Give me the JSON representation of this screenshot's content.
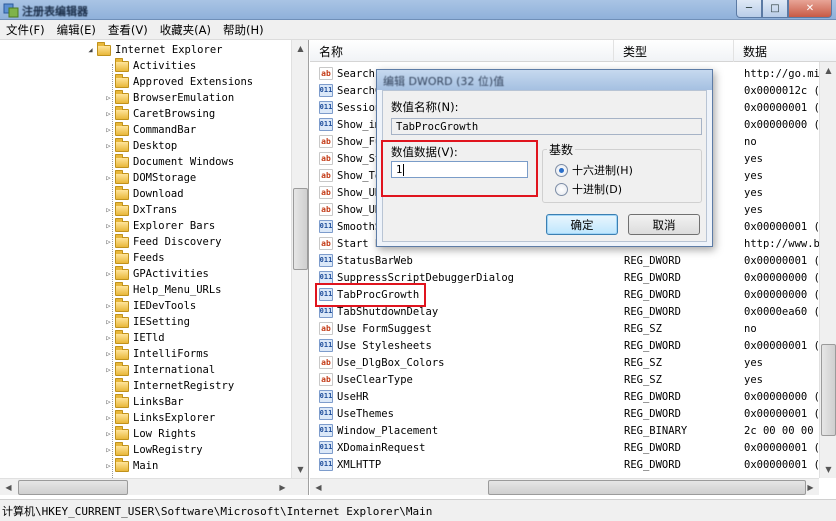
{
  "window": {
    "title": "注册表编辑器",
    "minimize": "─",
    "maximize": "□",
    "close": "✕"
  },
  "menu": [
    "文件(F)",
    "编辑(E)",
    "查看(V)",
    "收藏夹(A)",
    "帮助(H)"
  ],
  "tree": {
    "root": "Internet Explorer",
    "children": [
      {
        "label": "Activities",
        "expandable": false
      },
      {
        "label": "Approved Extensions",
        "expandable": false
      },
      {
        "label": "BrowserEmulation",
        "expandable": true
      },
      {
        "label": "CaretBrowsing",
        "expandable": true
      },
      {
        "label": "CommandBar",
        "expandable": true
      },
      {
        "label": "Desktop",
        "expandable": true
      },
      {
        "label": "Document Windows",
        "expandable": false
      },
      {
        "label": "DOMStorage",
        "expandable": true
      },
      {
        "label": "Download",
        "expandable": false
      },
      {
        "label": "DxTrans",
        "expandable": true
      },
      {
        "label": "Explorer Bars",
        "expandable": true
      },
      {
        "label": "Feed Discovery",
        "expandable": true
      },
      {
        "label": "Feeds",
        "expandable": false
      },
      {
        "label": "GPActivities",
        "expandable": true
      },
      {
        "label": "Help_Menu_URLs",
        "expandable": false
      },
      {
        "label": "IEDevTools",
        "expandable": true
      },
      {
        "label": "IESetting",
        "expandable": true
      },
      {
        "label": "IETld",
        "expandable": true
      },
      {
        "label": "IntelliForms",
        "expandable": true
      },
      {
        "label": "International",
        "expandable": true
      },
      {
        "label": "InternetRegistry",
        "expandable": false
      },
      {
        "label": "LinksBar",
        "expandable": true
      },
      {
        "label": "LinksExplorer",
        "expandable": true
      },
      {
        "label": "Low Rights",
        "expandable": true
      },
      {
        "label": "LowRegistry",
        "expandable": true
      },
      {
        "label": "Main",
        "expandable": true
      }
    ]
  },
  "list": {
    "columns": [
      "名称",
      "类型",
      "数据"
    ],
    "rows": [
      {
        "name": "Search",
        "type": "",
        "data": "http://go.mi",
        "icon": "sz"
      },
      {
        "name": "SearchC",
        "type": "",
        "data": "0x0000012c (",
        "icon": "bin"
      },
      {
        "name": "Session",
        "type": "",
        "data": "0x00000001 (",
        "icon": "bin"
      },
      {
        "name": "Show_im",
        "type": "",
        "data": "0x00000000 (",
        "icon": "bin"
      },
      {
        "name": "Show_Fu",
        "type": "",
        "data": "no",
        "icon": "sz"
      },
      {
        "name": "Show_St",
        "type": "",
        "data": "yes",
        "icon": "sz"
      },
      {
        "name": "Show_To",
        "type": "",
        "data": "yes",
        "icon": "sz"
      },
      {
        "name": "Show_UR",
        "type": "",
        "data": "yes",
        "icon": "sz"
      },
      {
        "name": "Show_UR",
        "type": "",
        "data": "yes",
        "icon": "sz"
      },
      {
        "name": "SmoothS",
        "type": "",
        "data": "0x00000001 (",
        "icon": "bin"
      },
      {
        "name": "Start P",
        "type": "",
        "data": "http://www.b",
        "icon": "sz"
      },
      {
        "name": "StatusBarWeb",
        "type": "REG_DWORD",
        "data": "0x00000001 (",
        "icon": "bin"
      },
      {
        "name": "SuppressScriptDebuggerDialog",
        "type": "REG_DWORD",
        "data": "0x00000000 (",
        "icon": "bin"
      },
      {
        "name": "TabProcGrowth",
        "type": "REG_DWORD",
        "data": "0x00000000 (",
        "icon": "bin"
      },
      {
        "name": "TabShutdownDelay",
        "type": "REG_DWORD",
        "data": "0x0000ea60 (",
        "icon": "bin"
      },
      {
        "name": "Use FormSuggest",
        "type": "REG_SZ",
        "data": "no",
        "icon": "sz"
      },
      {
        "name": "Use Stylesheets",
        "type": "REG_DWORD",
        "data": "0x00000001 (",
        "icon": "bin"
      },
      {
        "name": "Use_DlgBox_Colors",
        "type": "REG_SZ",
        "data": "yes",
        "icon": "sz"
      },
      {
        "name": "UseClearType",
        "type": "REG_SZ",
        "data": "yes",
        "icon": "sz"
      },
      {
        "name": "UseHR",
        "type": "REG_DWORD",
        "data": "0x00000000 (",
        "icon": "bin"
      },
      {
        "name": "UseThemes",
        "type": "REG_DWORD",
        "data": "0x00000001 (",
        "icon": "bin"
      },
      {
        "name": "Window_Placement",
        "type": "REG_BINARY",
        "data": "2c 00 00 00",
        "icon": "bin"
      },
      {
        "name": "XDomainRequest",
        "type": "REG_DWORD",
        "data": "0x00000001 (",
        "icon": "bin"
      },
      {
        "name": "XMLHTTP",
        "type": "REG_DWORD",
        "data": "0x00000001 (",
        "icon": "bin"
      }
    ]
  },
  "status": {
    "path": "计算机\\HKEY_CURRENT_USER\\Software\\Microsoft\\Internet Explorer\\Main"
  },
  "dialog": {
    "title": "编辑 DWORD (32 位)值",
    "name_label": "数值名称(N):",
    "name_value": "TabProcGrowth",
    "data_label": "数值数据(V):",
    "data_value": "1",
    "base_label": "基数",
    "hex_label": "十六进制(H)",
    "dec_label": "十进制(D)",
    "ok_label": "确定",
    "cancel_label": "取消"
  }
}
